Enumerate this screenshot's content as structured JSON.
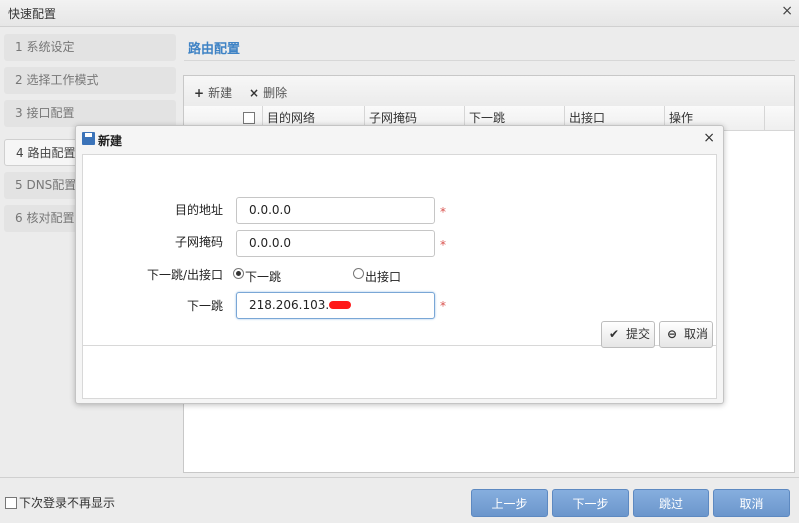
{
  "window": {
    "title": "快速配置",
    "close_glyph": "×"
  },
  "steps": [
    {
      "label": "1 系统设定"
    },
    {
      "label": "2 选择工作模式"
    },
    {
      "label": "3 接口配置"
    },
    {
      "label": "4 路由配置"
    },
    {
      "label": "5 DNS配置"
    },
    {
      "label": "6 核对配置"
    }
  ],
  "active_step": 3,
  "route": {
    "title": "路由配置",
    "toolbar": {
      "new_label": "新建",
      "delete_label": "删除",
      "new_icon": "+",
      "delete_icon": "×"
    },
    "columns": [
      "目的网络",
      "子网掩码",
      "下一跳",
      "出接口",
      "操作"
    ]
  },
  "dialog": {
    "title": "新建",
    "close_glyph": "×",
    "fields": {
      "dest_label": "目的地址",
      "dest_value": "0.0.0.0",
      "mask_label": "子网掩码",
      "mask_value": "0.0.0.0",
      "hop_iface_label": "下一跳/出接口",
      "option_nexthop": "下一跳",
      "option_iface": "出接口",
      "nexthop_label": "下一跳",
      "nexthop_value": "218.206.103."
    },
    "required_mark": "*",
    "submit_label": "提交",
    "cancel_label": "取消",
    "submit_icon": "✔",
    "cancel_icon": "⊖"
  },
  "footer": {
    "no_show_label": "下次登录不再显示",
    "prev_label": "上一步",
    "next_label": "下一步",
    "skip_label": "跳过",
    "cancel_label": "取消"
  },
  "colors": {
    "accent": "#3f83c5",
    "button": "#7aa2d6",
    "required": "#d9534f"
  }
}
